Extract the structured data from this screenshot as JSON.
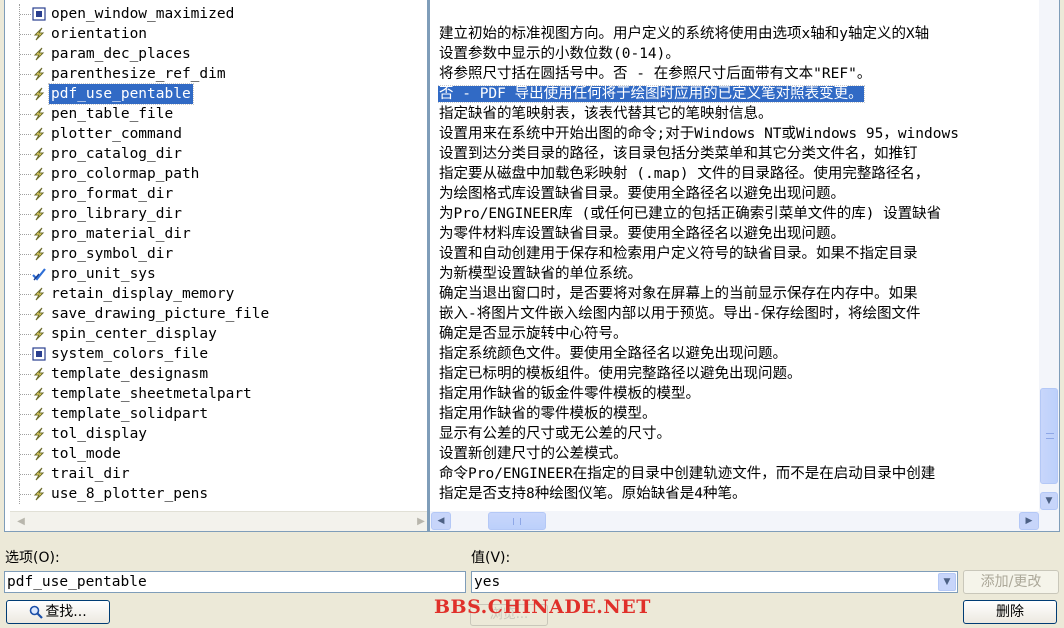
{
  "options_tree": {
    "items": [
      {
        "name": "open_window_maximized",
        "icon": "list-option-icon"
      },
      {
        "name": "orientation",
        "icon": "lightning-option-icon"
      },
      {
        "name": "param_dec_places",
        "icon": "lightning-option-icon"
      },
      {
        "name": "parenthesize_ref_dim",
        "icon": "lightning-option-icon"
      },
      {
        "name": "pdf_use_pentable",
        "icon": "lightning-option-icon",
        "selected": true
      },
      {
        "name": "pen_table_file",
        "icon": "lightning-option-icon"
      },
      {
        "name": "plotter_command",
        "icon": "lightning-option-icon"
      },
      {
        "name": "pro_catalog_dir",
        "icon": "lightning-option-icon"
      },
      {
        "name": "pro_colormap_path",
        "icon": "lightning-option-icon"
      },
      {
        "name": "pro_format_dir",
        "icon": "lightning-option-icon"
      },
      {
        "name": "pro_library_dir",
        "icon": "lightning-option-icon"
      },
      {
        "name": "pro_material_dir",
        "icon": "lightning-option-icon"
      },
      {
        "name": "pro_symbol_dir",
        "icon": "lightning-option-icon"
      },
      {
        "name": "pro_unit_sys",
        "icon": "checkmark-option-icon"
      },
      {
        "name": "retain_display_memory",
        "icon": "lightning-option-icon"
      },
      {
        "name": "save_drawing_picture_file",
        "icon": "lightning-option-icon"
      },
      {
        "name": "spin_center_display",
        "icon": "lightning-option-icon"
      },
      {
        "name": "system_colors_file",
        "icon": "list-option-icon"
      },
      {
        "name": "template_designasm",
        "icon": "lightning-option-icon"
      },
      {
        "name": "template_sheetmetalpart",
        "icon": "lightning-option-icon"
      },
      {
        "name": "template_solidpart",
        "icon": "lightning-option-icon"
      },
      {
        "name": "tol_display",
        "icon": "lightning-option-icon"
      },
      {
        "name": "tol_mode",
        "icon": "lightning-option-icon"
      },
      {
        "name": "trail_dir",
        "icon": "lightning-option-icon"
      },
      {
        "name": "use_8_plotter_pens",
        "icon": "lightning-option-icon"
      }
    ]
  },
  "descriptions": {
    "items": [
      {
        "text": ""
      },
      {
        "text": "建立初始的标准视图方向。用户定义的系统将使用由选项x轴和y轴定义的X轴"
      },
      {
        "text": "设置参数中显示的小数位数(0-14)。"
      },
      {
        "text": "将参照尺寸括在圆括号中。否 - 在参照尺寸后面带有文本\"REF\"。"
      },
      {
        "text": "否 - PDF 导出使用任何将于绘图时应用的已定义笔对照表变更。",
        "selected": true
      },
      {
        "text": "指定缺省的笔映射表，该表代替其它的笔映射信息。"
      },
      {
        "text": "设置用来在系统中开始出图的命令;对于Windows NT或Windows 95，windows"
      },
      {
        "text": "设置到达分类目录的路径，该目录包括分类菜单和其它分类文件名，如推钉"
      },
      {
        "text": "指定要从磁盘中加载色彩映射 (.map) 文件的目录路径。使用完整路径名，"
      },
      {
        "text": "为绘图格式库设置缺省目录。要使用全路径名以避免出现问题。"
      },
      {
        "text": "为Pro/ENGINEER库 (或任何已建立的包括正确索引菜单文件的库) 设置缺省"
      },
      {
        "text": "为零件材料库设置缺省目录。要使用全路径名以避免出现问题。"
      },
      {
        "text": "设置和自动创建用于保存和检索用户定义符号的缺省目录。如果不指定目录"
      },
      {
        "text": "为新模型设置缺省的单位系统。"
      },
      {
        "text": "确定当退出窗口时，是否要将对象在屏幕上的当前显示保存在内存中。如果"
      },
      {
        "text": "嵌入-将图片文件嵌入绘图内部以用于预览。导出-保存绘图时，将绘图文件"
      },
      {
        "text": "确定是否显示旋转中心符号。"
      },
      {
        "text": "指定系统颜色文件。要使用全路径名以避免出现问题。"
      },
      {
        "text": "指定已标明的模板组件。使用完整路径以避免出现问题。"
      },
      {
        "text": "指定用作缺省的钣金件零件模板的模型。"
      },
      {
        "text": "指定用作缺省的零件模板的模型。"
      },
      {
        "text": "显示有公差的尺寸或无公差的尺寸。"
      },
      {
        "text": "设置新创建尺寸的公差模式。"
      },
      {
        "text": "命令Pro/ENGINEER在指定的目录中创建轨迹文件，而不是在启动目录中创建"
      },
      {
        "text": "指定是否支持8种绘图仪笔。原始缺省是4种笔。"
      }
    ]
  },
  "form": {
    "option_label": "选项(O):",
    "option_value": "pdf_use_pentable",
    "value_label": "值(V):",
    "value_selected": "yes",
    "add_change_label": "添加/更改",
    "find_label": "查找...",
    "delete_label": "删除",
    "browse_label": "浏览..."
  },
  "watermark": "BBS.CHINADE.NET",
  "colors": {
    "selection": "#316ac5",
    "pane_border": "#7f9db9",
    "dialog_bg": "#ece9d8",
    "watermark": "#e0302a"
  }
}
